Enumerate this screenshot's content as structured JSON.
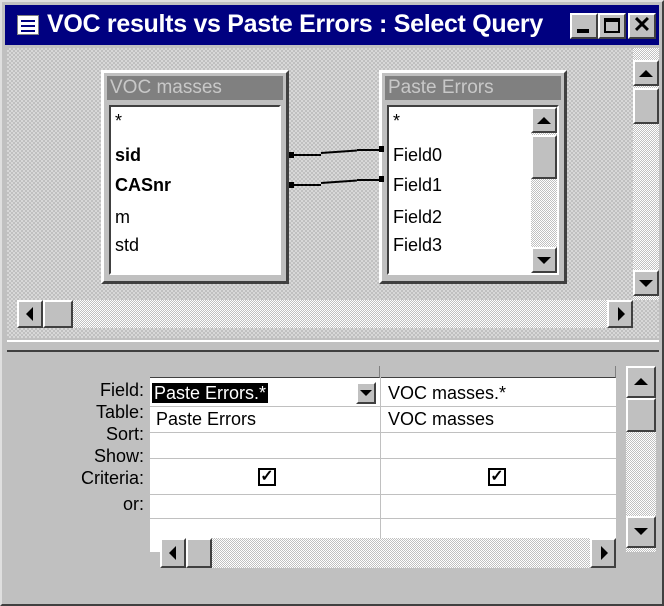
{
  "window": {
    "title": "VOC results vs Paste Errors : Select Query",
    "controls": {
      "close": "✕"
    }
  },
  "field_lists": [
    {
      "name": "VOC masses",
      "items": [
        {
          "label": "*",
          "bold": false
        },
        {
          "label": "sid",
          "bold": true
        },
        {
          "label": "CASnr",
          "bold": true
        },
        {
          "label": "m",
          "bold": false
        },
        {
          "label": "std",
          "bold": false
        }
      ]
    },
    {
      "name": "Paste Errors",
      "items": [
        {
          "label": "*",
          "bold": false
        },
        {
          "label": "Field0",
          "bold": false
        },
        {
          "label": "Field1",
          "bold": false
        },
        {
          "label": "Field2",
          "bold": false
        },
        {
          "label": "Field3",
          "bold": false
        }
      ]
    }
  ],
  "grid": {
    "row_labels": [
      "Field:",
      "Table:",
      "Sort:",
      "Show:",
      "Criteria:",
      "or:"
    ],
    "columns": [
      {
        "field": "Paste Errors.*",
        "table": "Paste Errors",
        "sort": "",
        "show": true,
        "criteria": "",
        "or": ""
      },
      {
        "field": "VOC masses.*",
        "table": "VOC masses",
        "sort": "",
        "show": true,
        "criteria": "",
        "or": ""
      }
    ]
  },
  "check_glyph": "✓"
}
